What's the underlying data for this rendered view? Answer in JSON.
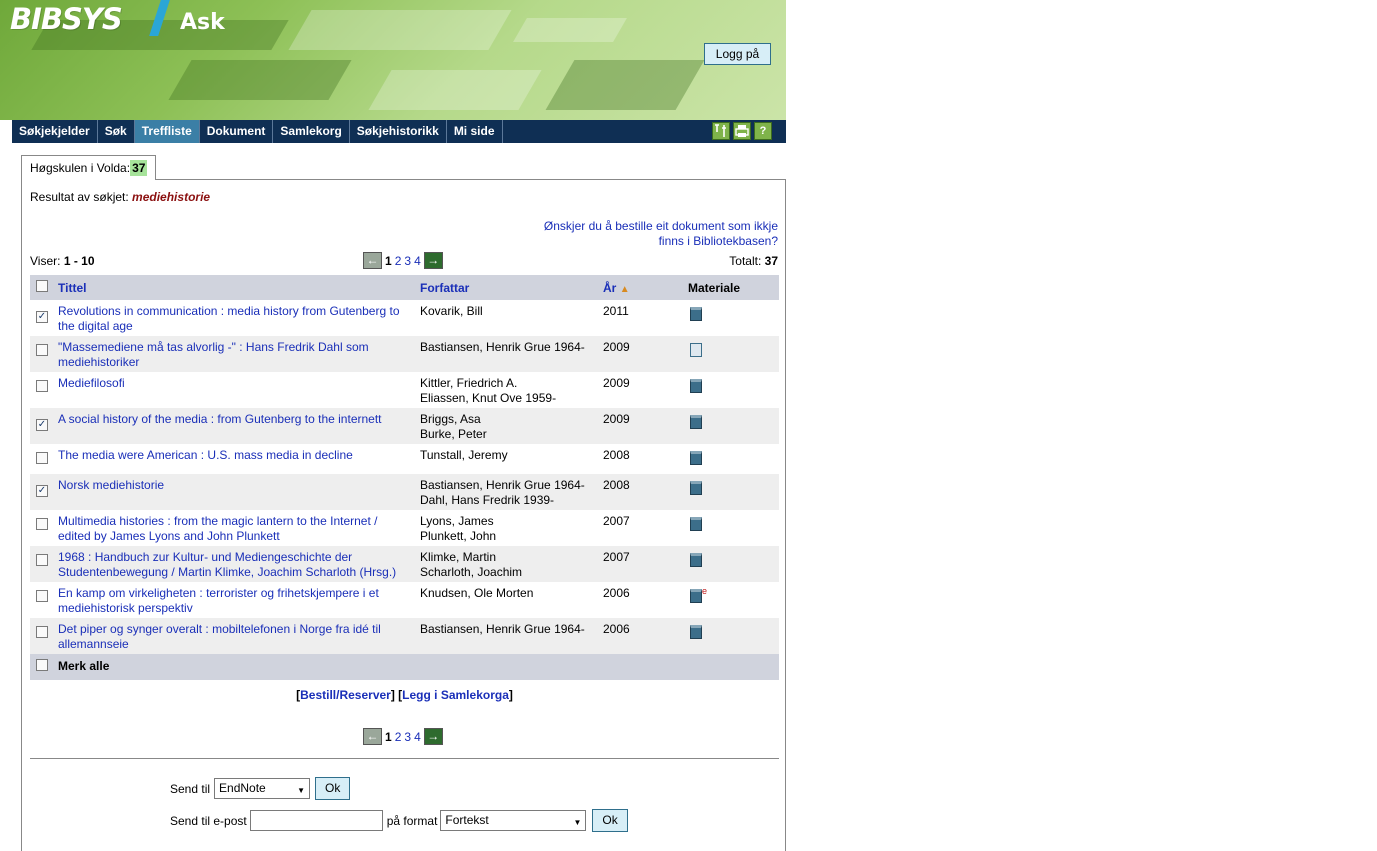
{
  "header": {
    "logo": "BIBSYS",
    "app_title": "Ask",
    "login_label": "Logg på"
  },
  "nav": {
    "items": [
      {
        "label": "Søkjekjelder"
      },
      {
        "label": "Søk"
      },
      {
        "label": "Treffliste",
        "active": true
      },
      {
        "label": "Dokument"
      },
      {
        "label": "Samlekorg"
      },
      {
        "label": "Søkjehistorikk"
      },
      {
        "label": "Mi side"
      }
    ],
    "help_label": "?"
  },
  "tab": {
    "label": "Høgskulen i Volda:",
    "count": "37"
  },
  "search": {
    "label": "Resultat av søkjet:",
    "query": "mediehistorie"
  },
  "order_link": "Ønskjer du å bestille eit dokument som ikkje finns i Bibliotekbasen?",
  "showing": {
    "label": "Viser:",
    "range": "1 - 10"
  },
  "total": {
    "label": "Totalt:",
    "count": "37"
  },
  "pager": {
    "pages": [
      "1",
      "2",
      "3",
      "4"
    ],
    "current": "1",
    "prev_label": "←",
    "next_label": "→"
  },
  "table": {
    "columns": {
      "title": "Tittel",
      "author": "Forfattar",
      "year": "År",
      "material": "Materiale"
    },
    "rows": [
      {
        "checked": true,
        "title": "Revolutions in communication : media history from Gutenberg to the digital age",
        "authors": [
          "Kovarik, Bill"
        ],
        "year": "2011",
        "material": "book"
      },
      {
        "checked": false,
        "title": "\"Massemediene må tas alvorlig -\" : Hans Fredrik Dahl som mediehistoriker",
        "authors": [
          "Bastiansen, Henrik Grue 1964-"
        ],
        "year": "2009",
        "material": "article"
      },
      {
        "checked": false,
        "title": "Mediefilosofi",
        "authors": [
          "Kittler, Friedrich A.",
          "Eliassen, Knut Ove 1959-"
        ],
        "year": "2009",
        "material": "book"
      },
      {
        "checked": true,
        "title": "A social history of the media : from Gutenberg to the internett",
        "authors": [
          "Briggs, Asa",
          "Burke, Peter"
        ],
        "year": "2009",
        "material": "book"
      },
      {
        "checked": false,
        "title": "The media were American : U.S. mass media in decline",
        "authors": [
          "Tunstall, Jeremy"
        ],
        "year": "2008",
        "material": "book"
      },
      {
        "checked": true,
        "title": "Norsk mediehistorie",
        "authors": [
          "Bastiansen, Henrik Grue 1964-",
          "Dahl, Hans Fredrik 1939-"
        ],
        "year": "2008",
        "material": "book"
      },
      {
        "checked": false,
        "title": "Multimedia histories : from the magic lantern to the Internet / edited by James Lyons and John Plunkett",
        "authors": [
          "Lyons, James",
          "Plunkett, John"
        ],
        "year": "2007",
        "material": "book"
      },
      {
        "checked": false,
        "title": "1968 : Handbuch zur Kultur- und Mediengeschichte der Studentenbewegung / Martin Klimke, Joachim Scharloth (Hrsg.)",
        "authors": [
          "Klimke, Martin",
          "Scharloth, Joachim"
        ],
        "year": "2007",
        "material": "book"
      },
      {
        "checked": false,
        "title": "En kamp om virkeligheten : terrorister og frihetskjempere i et mediehistorisk perspektiv",
        "authors": [
          "Knudsen, Ole Morten"
        ],
        "year": "2006",
        "material": "ebook"
      },
      {
        "checked": false,
        "title": "Det piper og synger overalt : mobiltelefonen i Norge fra idé til allemannseie",
        "authors": [
          "Bastiansen, Henrik Grue 1964-"
        ],
        "year": "2006",
        "material": "book"
      }
    ],
    "mark_all_label": "Merk alle"
  },
  "actions": {
    "order_label": "Bestill/Reserver",
    "basket_label": "Legg i Samlekorga"
  },
  "send": {
    "to_label": "Send til",
    "to_value": "EndNote",
    "ok_label": "Ok",
    "email_label": "Send til e-post",
    "format_label": "på format",
    "format_value": "Fortekst"
  }
}
